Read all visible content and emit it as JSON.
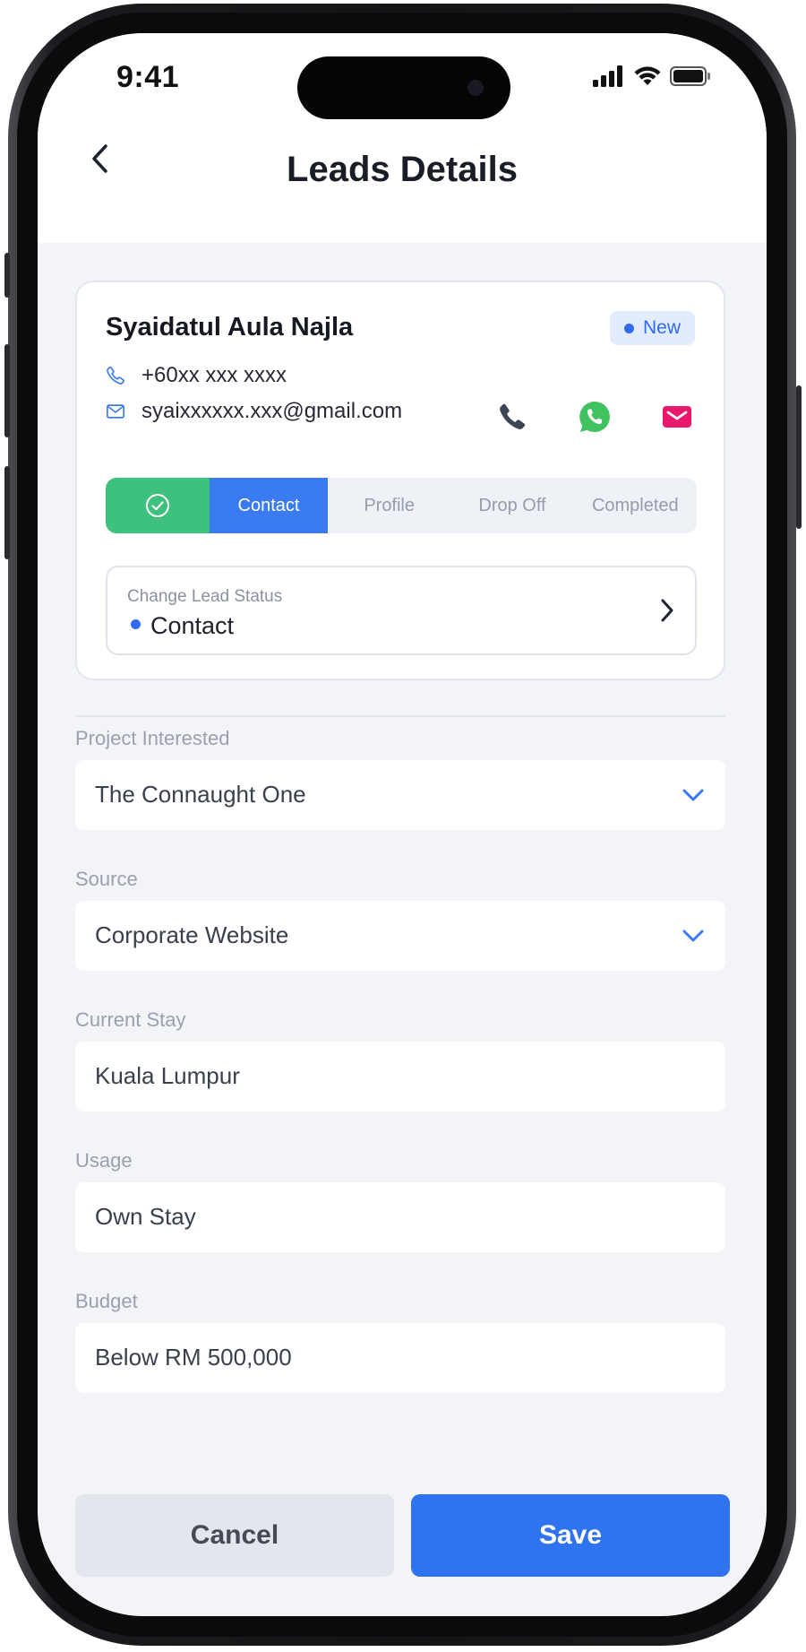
{
  "status_bar": {
    "time": "9:41"
  },
  "header": {
    "title": "Leads Details",
    "back_icon": "chevron-left-icon"
  },
  "lead": {
    "name": "Syaidatul Aula Najla",
    "badge": "New",
    "phone": "+60xx xxx xxxx",
    "email": "syaixxxxxx.xxx@gmail.com",
    "actions": [
      "phone-icon",
      "whatsapp-icon",
      "mail-icon"
    ]
  },
  "stepper": {
    "steps": [
      "Contact",
      "Profile",
      "Drop Off",
      "Completed"
    ],
    "current": "Contact"
  },
  "lead_status": {
    "label": "Change Lead Status",
    "value": "Contact"
  },
  "form": {
    "project_label": "Project Interested",
    "project_value": "The Connaught One",
    "source_label": "Source",
    "source_value": "Corporate Website",
    "stay_label": "Current Stay",
    "stay_value": "Kuala Lumpur",
    "usage_label": "Usage",
    "usage_value": "Own Stay",
    "budget_label": "Budget",
    "budget_value": "Below RM 500,000"
  },
  "buttons": {
    "cancel": "Cancel",
    "save": "Save"
  },
  "colors": {
    "primary": "#2f73ef",
    "success": "#3ec17c",
    "whatsapp": "#3fc25f",
    "mail": "#e8196a",
    "background": "#f3f4f8"
  }
}
